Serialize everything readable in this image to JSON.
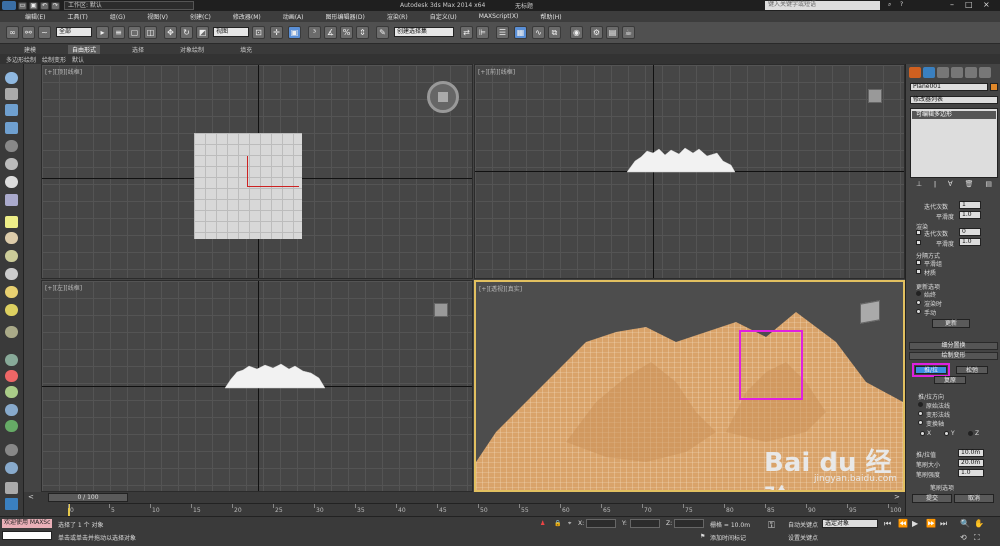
{
  "titlebar": {
    "workspace": "工作区: 默认",
    "app_title": "Autodesk 3ds Max  2014 x64",
    "document": "无标题",
    "search_placeholder": "键入关键字或短语"
  },
  "menu": [
    "编辑(E)",
    "工具(T)",
    "组(G)",
    "视图(V)",
    "创建(C)",
    "修改器(M)",
    "动画(A)",
    "图形编辑器(D)",
    "渲染(R)",
    "自定义(U)",
    "MAXScript(X)",
    "帮助(H)"
  ],
  "toolbar": {
    "selection_filter": "全部",
    "reference_coord": "视图",
    "named_selection": "创建选择集"
  },
  "ribbon": {
    "tabs": [
      "建模",
      "自由形式",
      "选择",
      "对象绘制",
      "填充"
    ],
    "active_tab": "自由形式",
    "sub": [
      "多边形绘制",
      "绘制变形",
      "默认"
    ]
  },
  "viewports": {
    "top": "[+][顶][线框]",
    "front": "[+][前][线框]",
    "left": "[+][左][线框]",
    "perspective": "[+][透视][真实]"
  },
  "command_panel": {
    "object_name": "Plane001",
    "modifier_list": "修改器列表",
    "stack_item": "可编辑多边形",
    "subdivision": {
      "iterations_label": "迭代次数",
      "iterations_value": "1",
      "smoothness_label": "平滑度",
      "smoothness_value": "1.0",
      "render_label": "渲染",
      "render_iterations_label": "迭代次数",
      "render_iterations_value": "0",
      "render_smooth_label": "平滑度",
      "render_smooth_value": "1.0"
    },
    "separate_by": {
      "title": "分隔方式",
      "smoothing_groups": "平滑组",
      "materials": "材质"
    },
    "update": {
      "title": "更新选项",
      "always": "始终",
      "when_rendering": "渲染时",
      "manually": "手动",
      "button": "更新"
    },
    "rollouts": {
      "subdivision_displacement": "细分置换",
      "paint_deformation": "绘制变形"
    },
    "paint": {
      "push_pull": "推/拉",
      "relax": "松弛",
      "revert": "复原",
      "direction_title": "推/拉方向",
      "original_normals": "原始法线",
      "deformed_normals": "变形法线",
      "transform_axis": "变换轴",
      "axis_x": "X",
      "axis_y": "Y",
      "axis_z": "Z",
      "push_pull_value_label": "推/拉值",
      "push_pull_value": "10.0m",
      "brush_size_label": "笔刷大小",
      "brush_size": "20.0m",
      "brush_strength_label": "笔刷强度",
      "brush_strength": "1.0",
      "brush_options": "笔刷选项",
      "commit": "提交",
      "cancel": "取消"
    }
  },
  "timeline": {
    "frame_display": "0 / 100",
    "ticks": [
      "0",
      "5",
      "10",
      "15",
      "20",
      "25",
      "30",
      "35",
      "40",
      "45",
      "50",
      "55",
      "60",
      "65",
      "70",
      "75",
      "80",
      "85",
      "90",
      "95",
      "100"
    ]
  },
  "status": {
    "welcome": "欢迎使用 MAXSc",
    "selected": "选择了 1 个 对象",
    "prompt": "单击或单击并拖动以选择对象",
    "x_label": "X:",
    "y_label": "Y:",
    "z_label": "Z:",
    "grid": "栅格 = 10.0m",
    "add_time_tag": "添加时间标记",
    "auto_key": "自动关键点",
    "set_key": "设置关键点",
    "key_filter_value": "选定对象"
  },
  "watermark": {
    "brand": "Bai du 经验",
    "url": "jingyan.baidu.com"
  },
  "colors": {
    "selection_box": "#e020e0",
    "terrain": "#d9a36a",
    "active_viewport_border": "#e2c060",
    "highlight_button": "#3a8ee6"
  }
}
